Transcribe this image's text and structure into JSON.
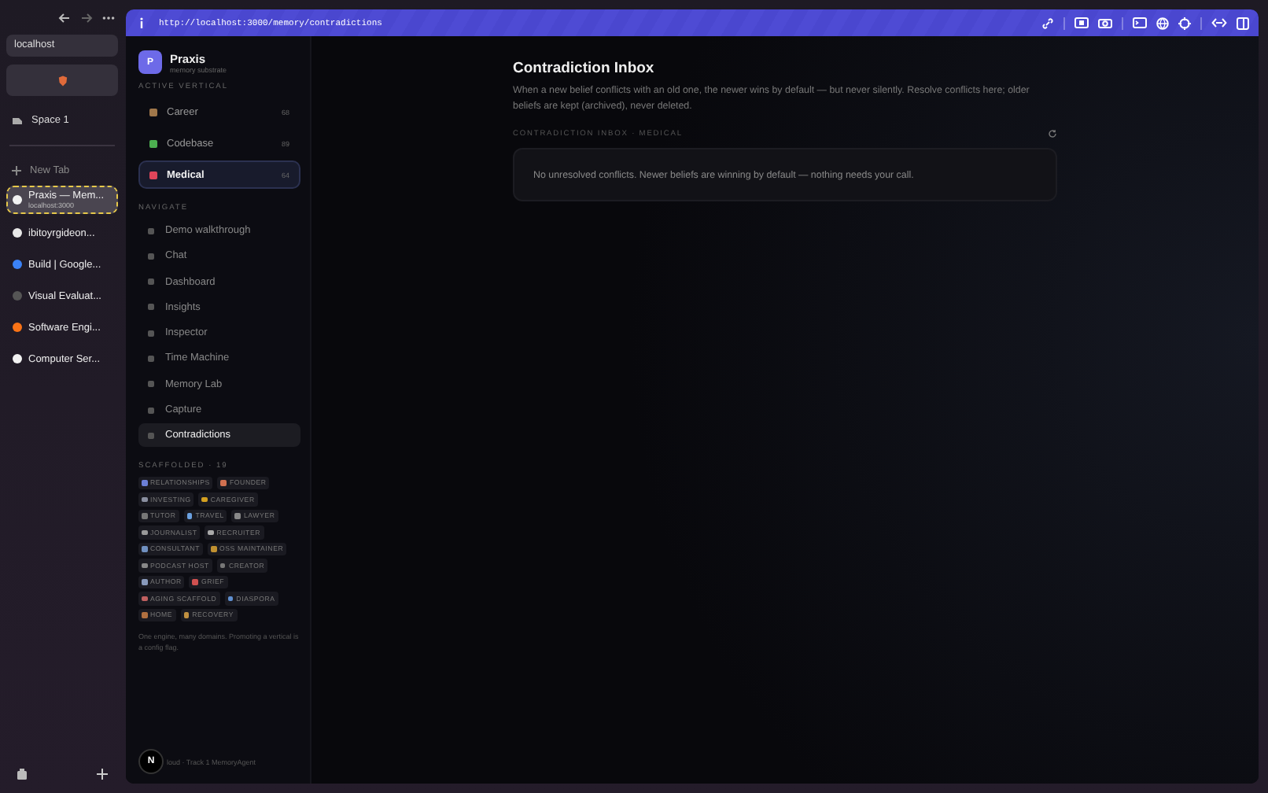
{
  "browser": {
    "address_field": "localhost",
    "space": "Space 1",
    "new_tab": "New Tab",
    "tabs": [
      {
        "title": "Praxis — Mem...",
        "subtitle": "localhost:3000",
        "selected": true
      },
      {
        "title": "ibitoyrgideon...",
        "selected": false
      },
      {
        "title": "Build | Google...",
        "selected": false
      },
      {
        "title": "Visual Evaluat...",
        "selected": false
      },
      {
        "title": "Software Engi...",
        "selected": false
      },
      {
        "title": "Computer Ser...",
        "selected": false
      }
    ]
  },
  "address_bar": {
    "url": "http://localhost:3000/memory/contradictions"
  },
  "app": {
    "logo": "P",
    "name": "Praxis",
    "subtitle": "memory substrate"
  },
  "active_vertical": {
    "heading": "ACTIVE VERTICAL",
    "items": [
      {
        "label": "Career",
        "count": "68",
        "selected": false
      },
      {
        "label": "Codebase",
        "count": "89",
        "selected": false
      },
      {
        "label": "Medical",
        "count": "64",
        "selected": true
      }
    ]
  },
  "navigate": {
    "heading": "NAVIGATE",
    "items": [
      {
        "label": "Demo walkthrough",
        "selected": false
      },
      {
        "label": "Chat",
        "selected": false
      },
      {
        "label": "Dashboard",
        "selected": false
      },
      {
        "label": "Insights",
        "selected": false
      },
      {
        "label": "Inspector",
        "selected": false
      },
      {
        "label": "Time Machine",
        "selected": false
      },
      {
        "label": "Memory Lab",
        "selected": false
      },
      {
        "label": "Capture",
        "selected": false
      },
      {
        "label": "Contradictions",
        "selected": true
      }
    ]
  },
  "scaffolded": {
    "heading": "SCAFFOLDED · 19",
    "tags": [
      "RELATIONSHIPS",
      "FOUNDER",
      "INVESTING",
      "CAREGIVER",
      "TUTOR",
      "TRAVEL",
      "LAWYER",
      "JOURNALIST",
      "RECRUITER",
      "CONSULTANT",
      "OSS MAINTAINER",
      "PODCAST HOST",
      "CREATOR",
      "AUTHOR",
      "GRIEF",
      "AGING SCAFFOLD",
      "DIASPORA",
      "HOME",
      "RECOVERY"
    ],
    "note": "One engine, many domains. Promoting a vertical is a config flag."
  },
  "footer": {
    "badge": "N",
    "text": "loud · Track 1 MemoryAgent"
  },
  "main": {
    "title": "Contradiction Inbox",
    "description": "When a new belief conflicts with an old one, the newer wins by default — but never silently. Resolve conflicts here; older beliefs are kept (archived), never deleted.",
    "section_label": "CONTRADICTION INBOX · MEDICAL",
    "empty_message": "No unresolved conflicts. Newer beliefs are winning by default — nothing needs your call."
  }
}
